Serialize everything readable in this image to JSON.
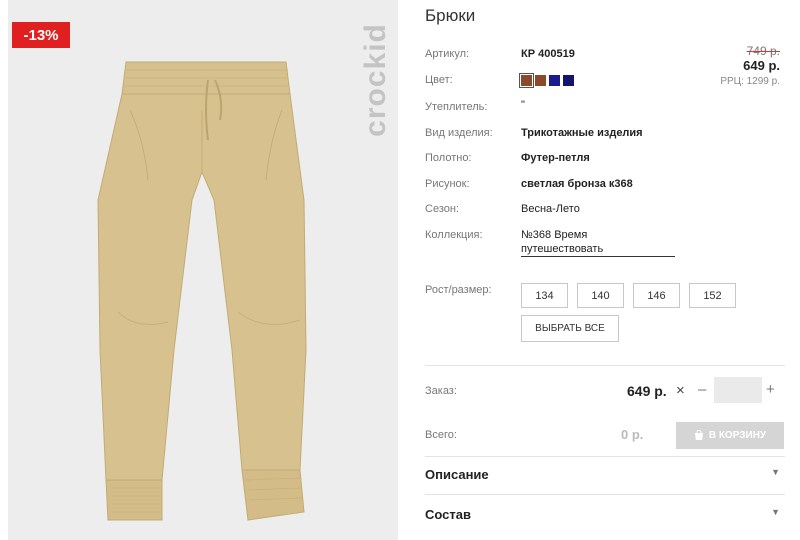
{
  "product": {
    "discount_badge": "-13%",
    "brand": "crockid",
    "title": "Брюки",
    "old_price": "749 р.",
    "price": "649 р.",
    "rrp": "РРЦ: 1299 р."
  },
  "specs": {
    "article_label": "Артикул:",
    "article_value": "КР 400519",
    "color_label": "Цвет:",
    "colors": [
      "#8b4a2b",
      "#8b4a2b",
      "#1c1c8c",
      "#141470"
    ],
    "insulation_label": "Утеплитель:",
    "insulation_value": "\"",
    "type_label": "Вид изделия:",
    "type_value": "Трикотажные изделия",
    "fabric_label": "Полотно:",
    "fabric_value": "Футер-петля",
    "pattern_label": "Рисунок:",
    "pattern_value": "светлая бронза к368",
    "season_label": "Сезон:",
    "season_value": "Весна-Лето",
    "collection_label": "Коллекция:",
    "collection_line1": "№368 Время",
    "collection_line2": "путешествовать"
  },
  "sizes": {
    "label": "Рост/размер:",
    "options": [
      "134",
      "140",
      "146",
      "152"
    ],
    "select_all": "ВЫБРАТЬ ВСЕ"
  },
  "order": {
    "label": "Заказ:",
    "price": "649 р.",
    "times": "×",
    "minus": "–",
    "plus": "+",
    "quantity": ""
  },
  "total": {
    "label": "Всего:",
    "value": "0 р.",
    "cart_button": "В КОРЗИНУ"
  },
  "accordions": {
    "description": "Описание",
    "composition": "Состав",
    "caret": "▼"
  },
  "icons": {
    "cart": "cart-icon",
    "caret": "caret-down-icon",
    "times": "times-icon"
  }
}
